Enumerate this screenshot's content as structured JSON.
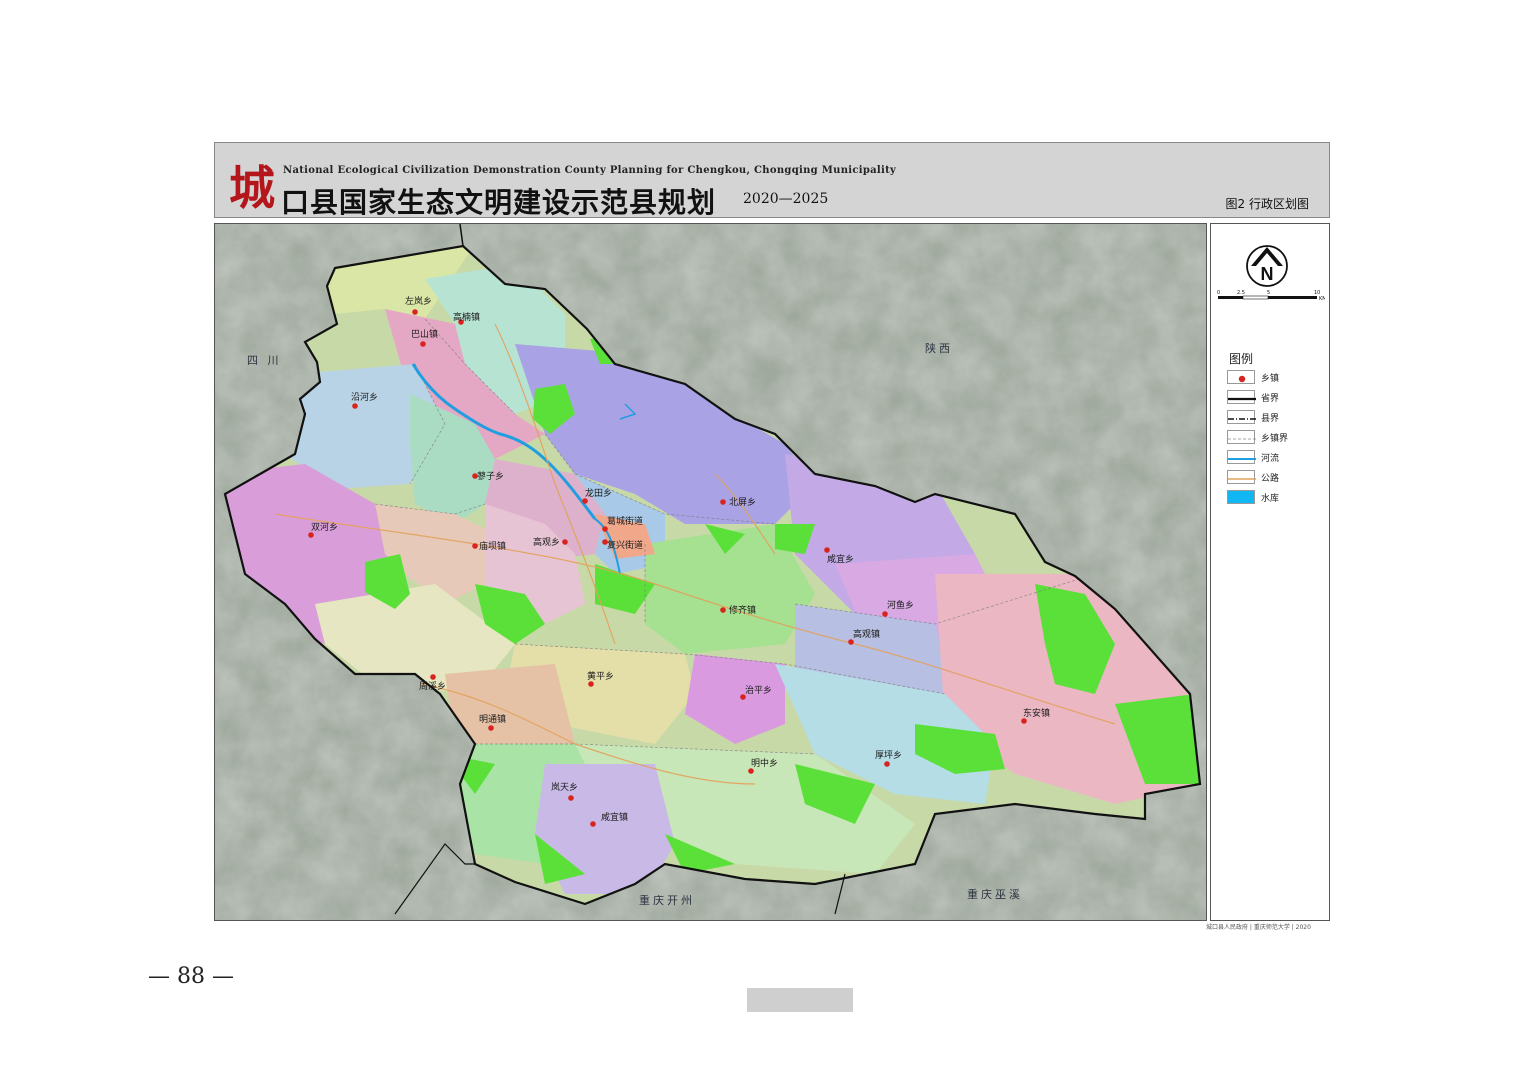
{
  "header": {
    "logo_char": "城",
    "subtitle_en": "National Ecological Civilization Demonstration County Planning for Chengkou, Chongqing Municipality",
    "title_cn": "口县国家生态文明建设示范县规划",
    "title_years": "2020—2025",
    "figure_label": "图2  行政区划图"
  },
  "neighbors": {
    "sichuan": "四  川",
    "shaanxi": "陕西",
    "kaizhou": "重庆开州",
    "wuxi": "重庆巫溪"
  },
  "towns": [
    {
      "name": "左岚乡"
    },
    {
      "name": "高楠镇"
    },
    {
      "name": "巴山镇"
    },
    {
      "name": "沿河乡"
    },
    {
      "name": "蓼子乡"
    },
    {
      "name": "北屏乡"
    },
    {
      "name": "龙田乡"
    },
    {
      "name": "葛城街道"
    },
    {
      "name": "复兴街道"
    },
    {
      "name": "双河乡"
    },
    {
      "name": "庙坝镇"
    },
    {
      "name": "高观乡"
    },
    {
      "name": "咸宜乡"
    },
    {
      "name": "修齐镇"
    },
    {
      "name": "河鱼乡"
    },
    {
      "name": "高观镇"
    },
    {
      "name": "周溪乡"
    },
    {
      "name": "黄平乡"
    },
    {
      "name": "治平乡"
    },
    {
      "name": "明通镇"
    },
    {
      "name": "东安镇"
    },
    {
      "name": "厚坪乡"
    },
    {
      "name": "明中乡"
    },
    {
      "name": "岚天乡"
    },
    {
      "name": "咸宜镇"
    }
  ],
  "legend": {
    "title": "图例",
    "items": [
      {
        "label": "乡镇",
        "kind": "town"
      },
      {
        "label": "省界",
        "kind": "province"
      },
      {
        "label": "县界",
        "kind": "county"
      },
      {
        "label": "乡镇界",
        "kind": "township"
      },
      {
        "label": "河流",
        "kind": "river"
      },
      {
        "label": "公路",
        "kind": "road"
      },
      {
        "label": "水库",
        "kind": "reservoir"
      }
    ],
    "scale_ticks": [
      "0",
      "2.5",
      "5",
      "10"
    ],
    "scale_unit": "KM",
    "north_label": "N"
  },
  "credit": "城口县人民政府 | 重庆师范大学 | 2020",
  "page_number": "— 88 —",
  "colors": {
    "town_dot": "#d9231f",
    "river": "#1f9fe0",
    "reservoir": "#10b7f2",
    "road": "#e3a15a",
    "forest_green": "#5be03a",
    "logo_red": "#b5161c"
  }
}
